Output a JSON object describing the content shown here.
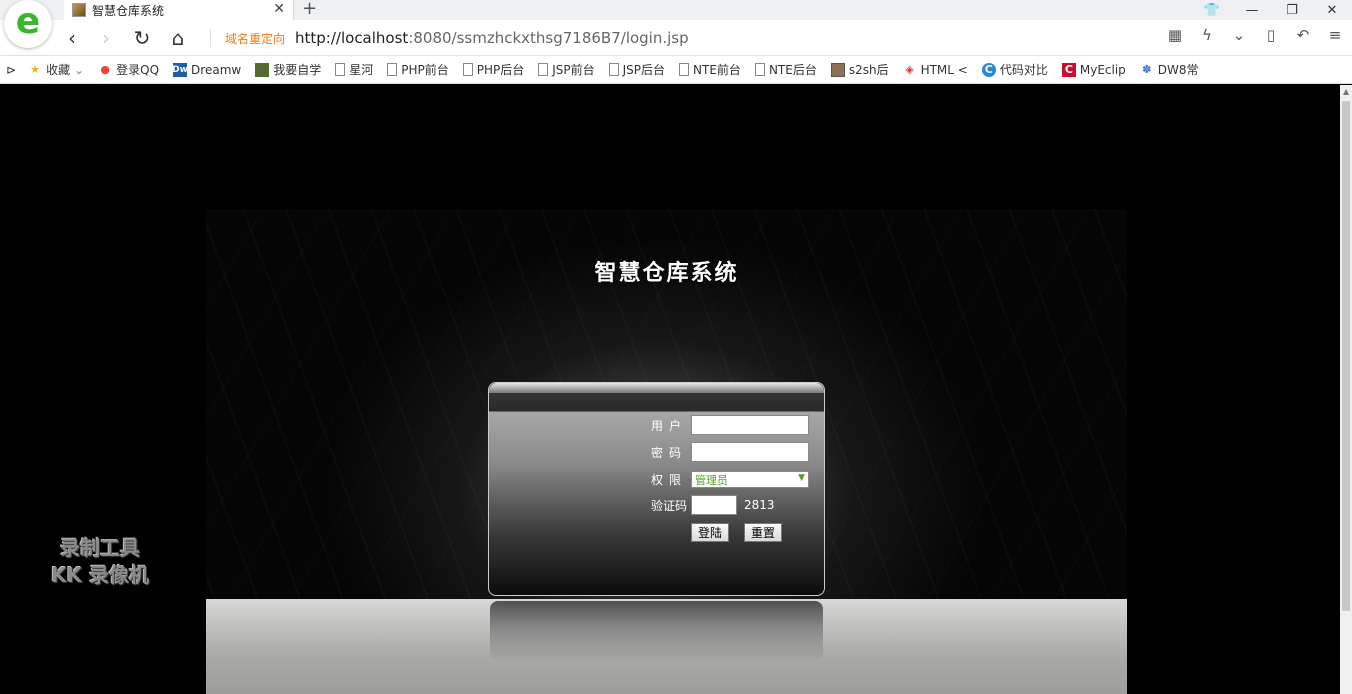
{
  "browser": {
    "tab_title": "智慧仓库系统",
    "tab_close": "✕",
    "new_tab": "+",
    "url_prefix": "域名重定向",
    "url_host": "http://localhost",
    "url_rest": ":8080/ssmzhckxthsg7186B7/login.jsp"
  },
  "bookmarks": [
    {
      "label": "收藏",
      "icon": "star-icon"
    },
    {
      "label": "登录QQ",
      "icon": "qq-icon"
    },
    {
      "label": "Dreamw",
      "icon": "dreamweaver-icon"
    },
    {
      "label": "我要自学",
      "icon": "image-icon"
    },
    {
      "label": "星河",
      "icon": "page-icon"
    },
    {
      "label": "PHP前台",
      "icon": "page-icon"
    },
    {
      "label": "PHP后台",
      "icon": "page-icon"
    },
    {
      "label": "JSP前台",
      "icon": "page-icon"
    },
    {
      "label": "JSP后台",
      "icon": "page-icon"
    },
    {
      "label": "NTE前台",
      "icon": "page-icon"
    },
    {
      "label": "NTE后台",
      "icon": "page-icon"
    },
    {
      "label": "s2sh后",
      "icon": "image-icon"
    },
    {
      "label": "HTML <",
      "icon": "html-icon"
    },
    {
      "label": "代码对比",
      "icon": "compare-icon"
    },
    {
      "label": "MyEclip",
      "icon": "myeclipse-icon"
    },
    {
      "label": "DW8常",
      "icon": "paw-icon"
    }
  ],
  "page": {
    "title": "智慧仓库系统",
    "username_label": "用户",
    "password_label": "密码",
    "role_label": "权限",
    "role_selected": "管理员",
    "captcha_label": "验证码",
    "captcha_value": "2813",
    "login_button": "登陆",
    "reset_button": "重置"
  },
  "watermark": {
    "line1": "录制工具",
    "line2": "KK 录像机"
  },
  "colors": {
    "url_prefix": "#f07a1a",
    "select_text": "#5a9a2a",
    "browser_logo": "#3cb52e"
  }
}
